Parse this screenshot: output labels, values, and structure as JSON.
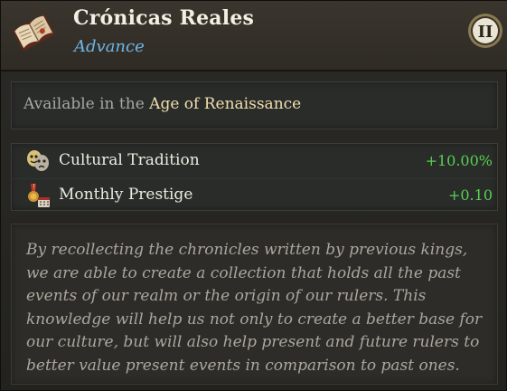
{
  "header": {
    "title": "Crónicas Reales",
    "subtitle": "Advance",
    "tier_badge": "II",
    "icon": "open-book-icon"
  },
  "age": {
    "prefix": "Available in the",
    "age_name": "Age of Renaissance"
  },
  "modifiers": [
    {
      "icon": "theater-masks-icon",
      "label": "Cultural Tradition",
      "value": "+10.00%"
    },
    {
      "icon": "prestige-medal-icon",
      "label": "Monthly Prestige",
      "value": "+0.10"
    }
  ],
  "description": "By recollecting the chronicles written by previous kings, we are able to create a collection that holds all the past events of our realm or the origin of our rulers. This knowledge will help us not only to create a better base for our culture, but will also help present and future rulers to better value present events in comparison to past ones.",
  "colors": {
    "positive": "#58cf52",
    "subtitle": "#6fb6e6",
    "highlight": "#f2dfae"
  }
}
